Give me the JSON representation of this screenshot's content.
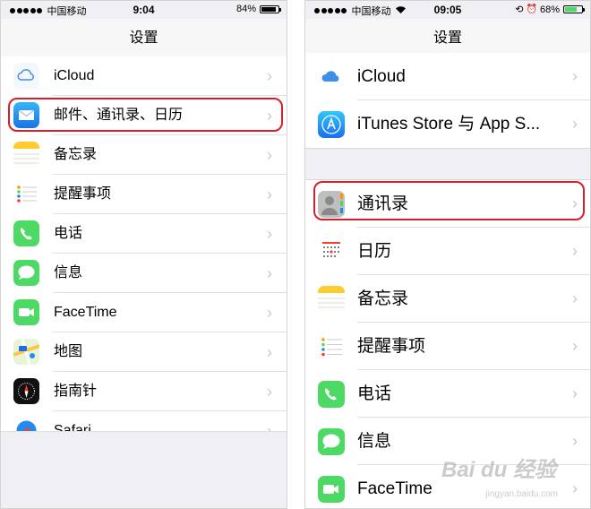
{
  "left_phone": {
    "status": {
      "carrier": "中国移动",
      "time": "9:04",
      "battery": "84%"
    },
    "nav_title": "设置",
    "rows": [
      {
        "label": "iCloud",
        "icon": "icloud-icon"
      },
      {
        "label": "邮件、通讯录、日历",
        "icon": "mail-icon"
      },
      {
        "label": "备忘录",
        "icon": "notes-icon"
      },
      {
        "label": "提醒事项",
        "icon": "reminders-icon"
      },
      {
        "label": "电话",
        "icon": "phone-icon"
      },
      {
        "label": "信息",
        "icon": "messages-icon"
      },
      {
        "label": "FaceTime",
        "icon": "facetime-icon"
      },
      {
        "label": "地图",
        "icon": "maps-icon"
      },
      {
        "label": "指南针",
        "icon": "compass-icon"
      },
      {
        "label": "Safari",
        "icon": "safari-icon"
      }
    ]
  },
  "right_phone": {
    "status": {
      "carrier": "中国移动",
      "time": "09:05",
      "battery": "68%"
    },
    "nav_title": "设置",
    "group1": [
      {
        "label": "iCloud",
        "icon": "icloud-icon"
      },
      {
        "label": "iTunes Store 与 App S...",
        "icon": "appstore-icon"
      }
    ],
    "group2": [
      {
        "label": "通讯录",
        "icon": "contacts-icon"
      },
      {
        "label": "日历",
        "icon": "calendar-icon"
      },
      {
        "label": "备忘录",
        "icon": "notes-icon"
      },
      {
        "label": "提醒事项",
        "icon": "reminders-icon"
      },
      {
        "label": "电话",
        "icon": "phone-icon"
      },
      {
        "label": "信息",
        "icon": "messages-icon"
      },
      {
        "label": "FaceTime",
        "icon": "facetime-icon"
      }
    ]
  },
  "chevron": "›",
  "colors": {
    "highlight": "#d81e2a",
    "green": "#4cd964",
    "blue": "#1e8cf0"
  }
}
